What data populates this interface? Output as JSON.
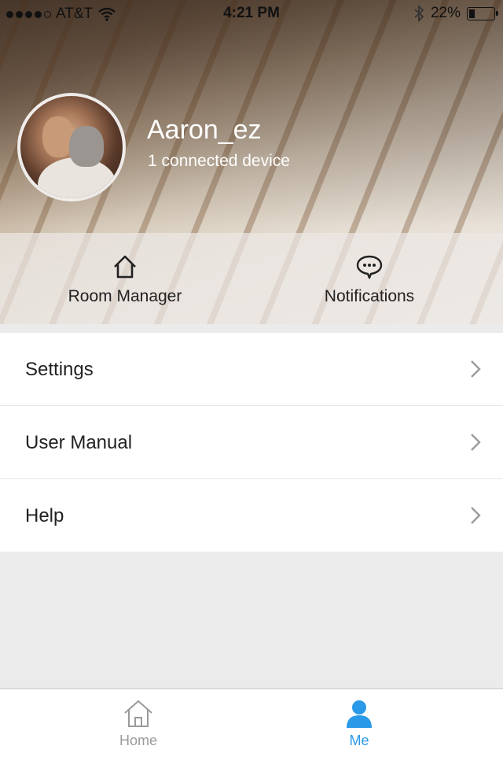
{
  "status_bar": {
    "carrier": "AT&T",
    "time": "4:21 PM",
    "battery": "22%",
    "battery_level": 0.22
  },
  "profile": {
    "username": "Aaron_ez",
    "device_count_text": "1 connected device"
  },
  "quick_actions": [
    {
      "label": "Room Manager",
      "icon": "house-icon"
    },
    {
      "label": "Notifications",
      "icon": "chat-bubble-icon"
    }
  ],
  "menu": [
    {
      "label": "Settings"
    },
    {
      "label": "User Manual"
    },
    {
      "label": "Help"
    }
  ],
  "tab_bar": [
    {
      "label": "Home",
      "icon": "home-icon",
      "active": false
    },
    {
      "label": "Me",
      "icon": "person-icon",
      "active": true
    }
  ],
  "colors": {
    "accent": "#2a9ae8",
    "inactive_tab": "#9a9a9a",
    "list_background": "#ffffff",
    "page_background": "#ebebeb"
  }
}
